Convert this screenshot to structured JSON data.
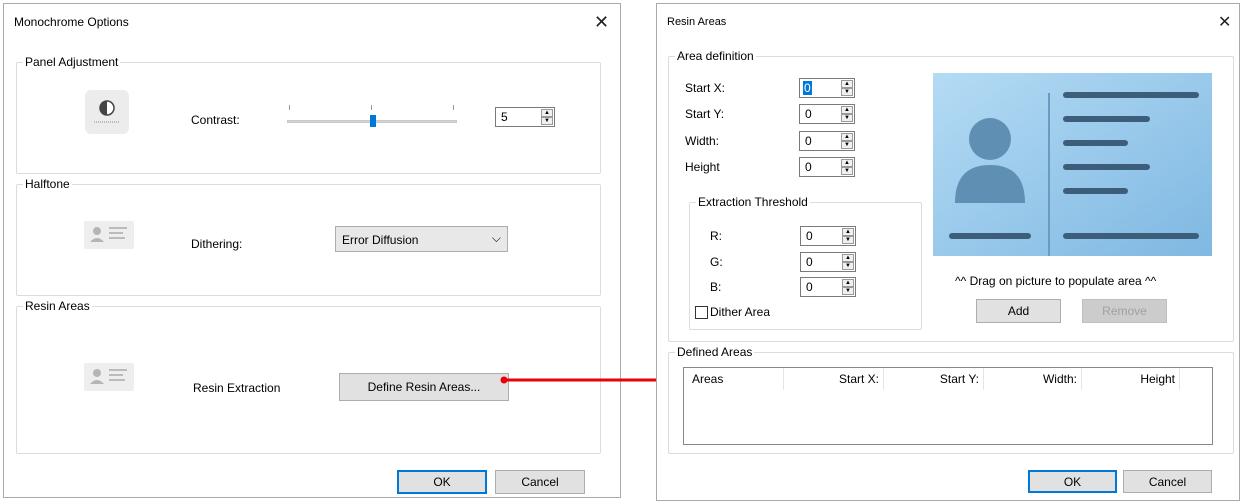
{
  "left_dialog": {
    "title": "Monochrome Options",
    "panel_adjustment": {
      "legend": "Panel Adjustment",
      "contrast_label": "Contrast:",
      "contrast_value": "5",
      "contrast_level": 0.5
    },
    "halftone": {
      "legend": "Halftone",
      "dithering_label": "Dithering:",
      "dithering_selected": "Error Diffusion"
    },
    "resin_areas": {
      "legend": "Resin Areas",
      "resin_extraction_label": "Resin Extraction",
      "define_button": "Define Resin Areas..."
    },
    "ok": "OK",
    "cancel": "Cancel"
  },
  "right_dialog": {
    "title": "Resin Areas",
    "area_definition": {
      "legend": "Area definition",
      "fields": [
        {
          "label": "Start X:",
          "value": "0"
        },
        {
          "label": "Start Y:",
          "value": "0"
        },
        {
          "label": "Width:",
          "value": "0"
        },
        {
          "label": "Height",
          "value": "0"
        }
      ],
      "extraction_threshold": {
        "legend": "Extraction Threshold",
        "fields": [
          {
            "label": "R:",
            "value": "0"
          },
          {
            "label": "G:",
            "value": "0"
          },
          {
            "label": "B:",
            "value": "0"
          }
        ]
      },
      "dither_area": "Dither Area",
      "drag_hint": "^^ Drag on picture to populate area ^^",
      "add": "Add",
      "remove": "Remove"
    },
    "defined_areas": {
      "legend": "Defined Areas",
      "columns": [
        "Areas",
        "Start X:",
        "Start Y:",
        "Width:",
        "Height"
      ]
    },
    "ok": "OK",
    "cancel": "Cancel"
  },
  "colors": {
    "accent": "#0078d7",
    "arrow": "#e8000b",
    "preview_bg": "#8ec4e9",
    "preview_fg": "#3c5e7a"
  }
}
